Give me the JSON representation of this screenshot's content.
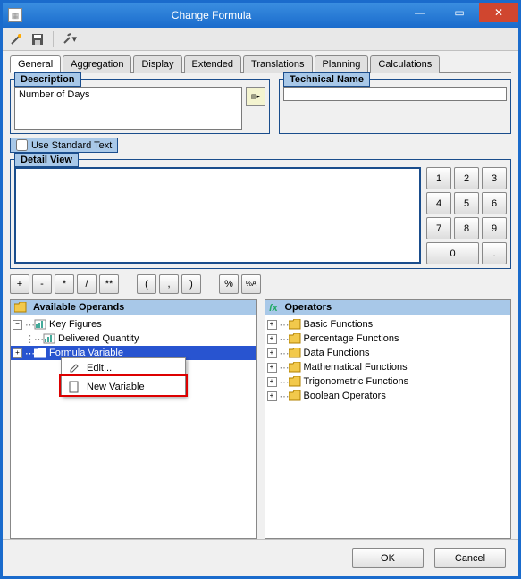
{
  "window": {
    "title": "Change Formula"
  },
  "toolbar_icons": {
    "wand": "wand-icon",
    "save": "save-icon",
    "tools": "tools-icon"
  },
  "tabs": [
    {
      "label": "General",
      "active": true
    },
    {
      "label": "Aggregation"
    },
    {
      "label": "Display"
    },
    {
      "label": "Extended"
    },
    {
      "label": "Translations"
    },
    {
      "label": "Planning"
    },
    {
      "label": "Calculations"
    }
  ],
  "description": {
    "title": "Description",
    "value": "Number of Days"
  },
  "technical": {
    "title": "Technical Name",
    "value": ""
  },
  "std_text": {
    "label": "Use Standard Text",
    "checked": false
  },
  "detail": {
    "title": "Detail View"
  },
  "keypad": [
    "1",
    "2",
    "3",
    "4",
    "5",
    "6",
    "7",
    "8",
    "9",
    "0",
    "."
  ],
  "operators_row": [
    "+",
    "-",
    "*",
    "/",
    "**",
    "(",
    ",",
    ")",
    "%",
    "%A"
  ],
  "avail": {
    "title": "Available Operands",
    "items": [
      {
        "label": "Key Figures",
        "kind": "kf-root",
        "indent": 0,
        "exp": "-"
      },
      {
        "label": "Delivered Quantity",
        "kind": "kf",
        "indent": 1
      },
      {
        "label": "Formula Variable",
        "kind": "folder",
        "indent": 1,
        "exp": "+",
        "selected": true
      }
    ]
  },
  "ops": {
    "title": "Operators",
    "items": [
      {
        "label": "Basic Functions"
      },
      {
        "label": "Percentage Functions"
      },
      {
        "label": "Data Functions"
      },
      {
        "label": "Mathematical Functions"
      },
      {
        "label": "Trigonometric Functions"
      },
      {
        "label": "Boolean Operators"
      }
    ]
  },
  "context": {
    "edit": "Edit...",
    "newvar": "New Variable"
  },
  "footer": {
    "ok": "OK",
    "cancel": "Cancel"
  }
}
